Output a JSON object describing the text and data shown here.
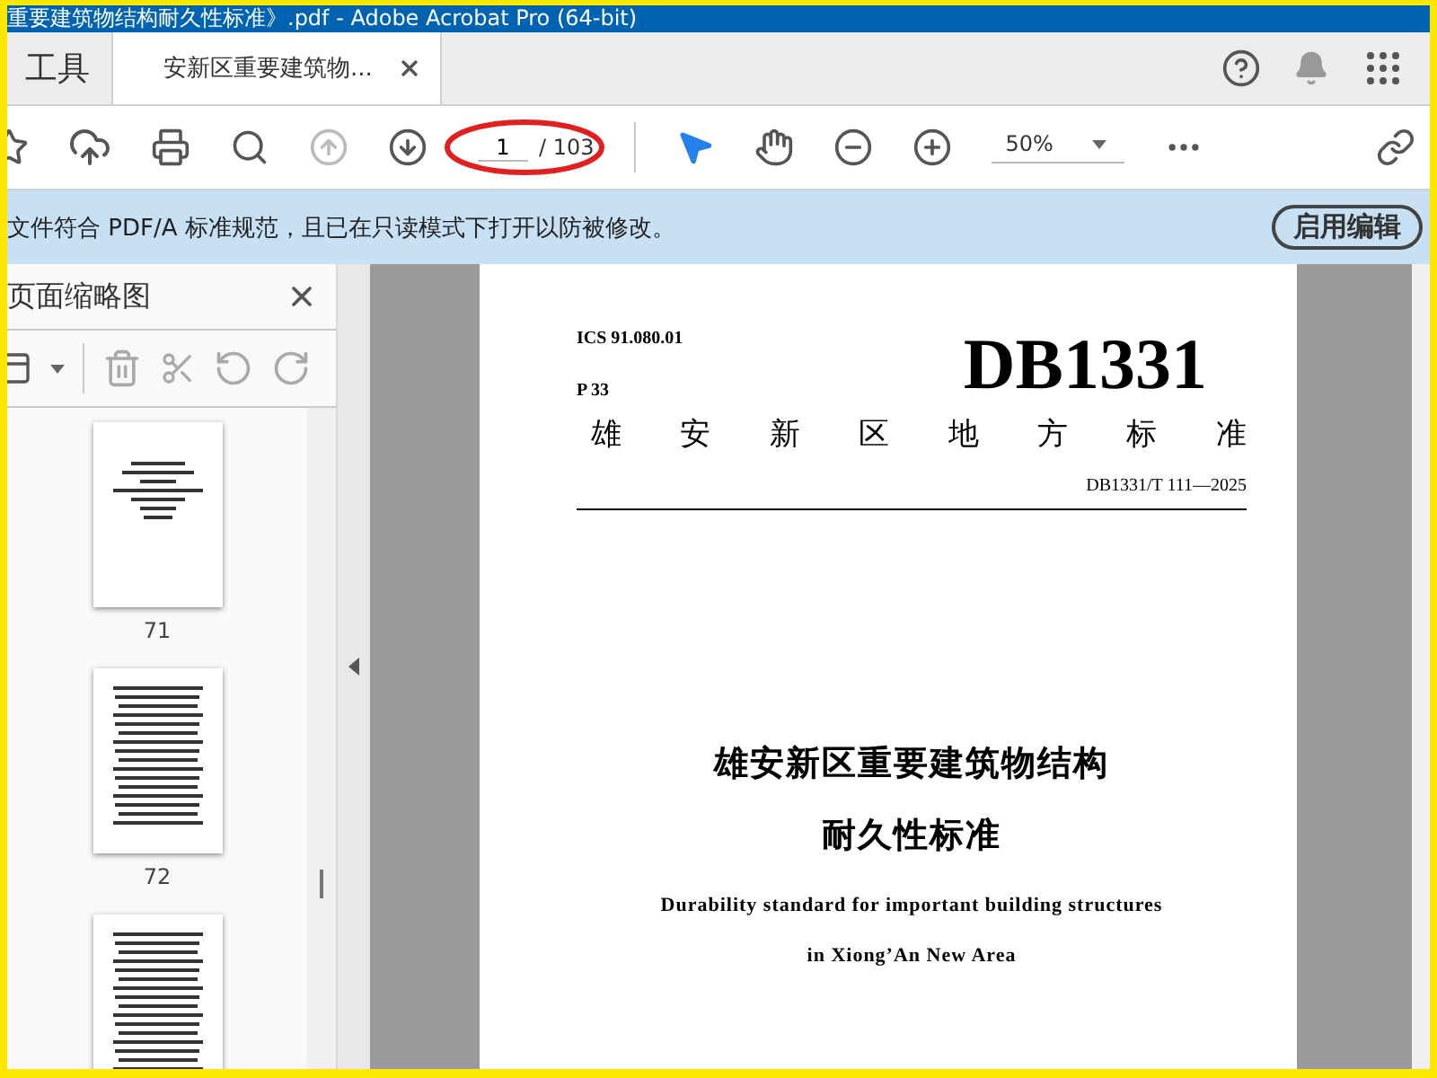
{
  "window": {
    "title": "重要建筑物结构耐久性标准》.pdf - Adobe Acrobat Pro (64-bit)"
  },
  "tabs": [
    {
      "label": "工具",
      "selected": false
    },
    {
      "label": "安新区重要建筑物...",
      "selected": true
    }
  ],
  "toolbar": {
    "page_current": "1",
    "page_total": "/ 103",
    "zoom": "50%",
    "previous_page_disabled": true,
    "next_page_disabled": false,
    "select_tool_selected": true,
    "hand_tool_selected": false
  },
  "notice": {
    "text": "文件符合 PDF/A 标准规范，且已在只读模式下打开以防被修改。",
    "button": "启用编辑"
  },
  "sidebar": {
    "title": "页面缩略图",
    "thumbnails": [
      {
        "label": "71",
        "kind": "cover",
        "selected": false
      },
      {
        "label": "72",
        "kind": "contents",
        "selected": false
      },
      {
        "kind": "contents",
        "selected": false
      }
    ]
  },
  "document": {
    "ics": "ICS 91.080.01",
    "class_code": "P 33",
    "code": "DB1331",
    "category": "雄安新区地方标准",
    "number": "DB1331/T 111—2025",
    "title_lines": [
      "雄安新区重要建筑物结构",
      "耐久性标准"
    ],
    "english_lines": [
      "Durability standard for important building structures",
      "in Xiong’An New Area"
    ]
  }
}
